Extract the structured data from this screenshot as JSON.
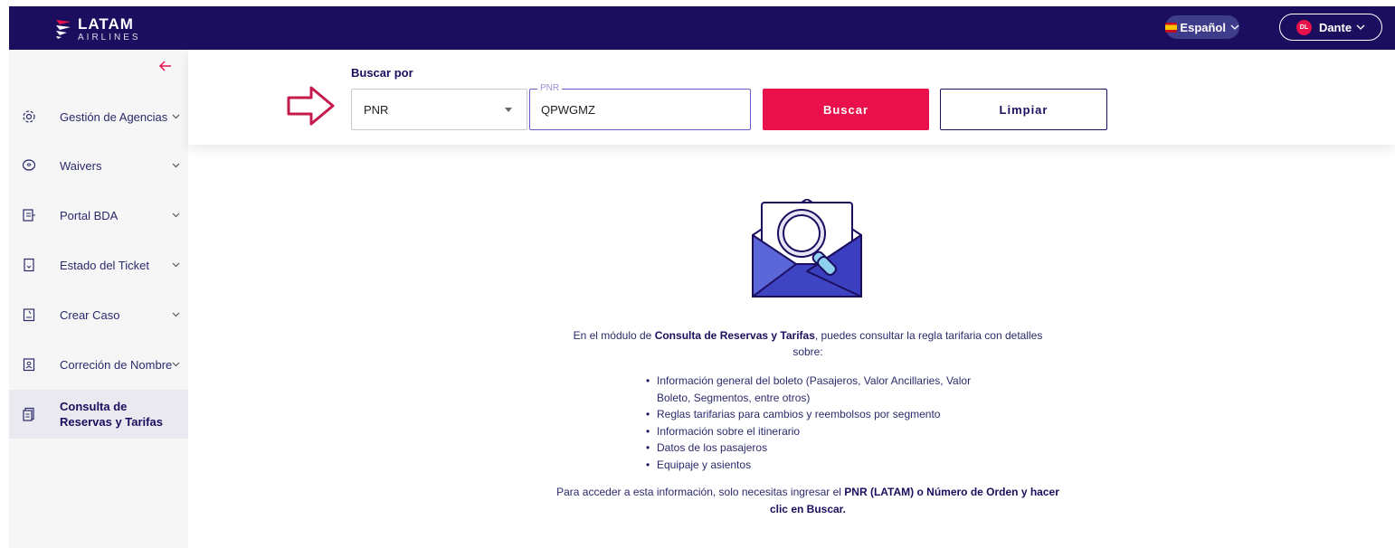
{
  "header": {
    "logo_title": "LATAM",
    "logo_sub": "AIRLINES",
    "language_label": "Español",
    "user_initials": "DL",
    "user_name": "Dante"
  },
  "sidebar": {
    "items": [
      {
        "label": "Gestión de Agencias",
        "icon": "gear-icon"
      },
      {
        "label": "Waivers",
        "icon": "heart-chat-icon"
      },
      {
        "label": "Portal BDA",
        "icon": "document-list-icon"
      },
      {
        "label": "Estado del Ticket",
        "icon": "ticket-icon"
      },
      {
        "label": "Crear Caso",
        "icon": "clipboard-icon"
      },
      {
        "label": "Correción de Nombre",
        "icon": "id-badge-icon"
      },
      {
        "label": "Consulta de Reservas y Tarifas",
        "icon": "receipt-icon"
      }
    ]
  },
  "search": {
    "title": "Buscar por",
    "select_value": "PNR",
    "field_label": "PNR",
    "field_value": "QPWGMZ",
    "search_button": "Buscar",
    "clear_button": "Limpiar"
  },
  "info": {
    "intro_prefix": "En el módulo de ",
    "intro_bold": "Consulta de Reservas y Tarifas",
    "intro_suffix": ", puedes consultar la regla tarifaria con detalles sobre:",
    "bullets": [
      "Información general del boleto (Pasajeros, Valor Ancillaries, Valor Boleto, Segmentos, entre otros)",
      "Reglas tarifarias para cambios y reembolsos por segmento",
      "Información sobre el itinerario",
      "Datos de los pasajeros",
      "Equipaje y asientos"
    ],
    "footer_prefix": "Para acceder a esta información, solo necesitas ingresar el ",
    "footer_bold": "PNR (LATAM) o Número de Orden y hacer clic en Buscar."
  },
  "colors": {
    "primary": "#1b0e5f",
    "accent": "#e8114b"
  }
}
